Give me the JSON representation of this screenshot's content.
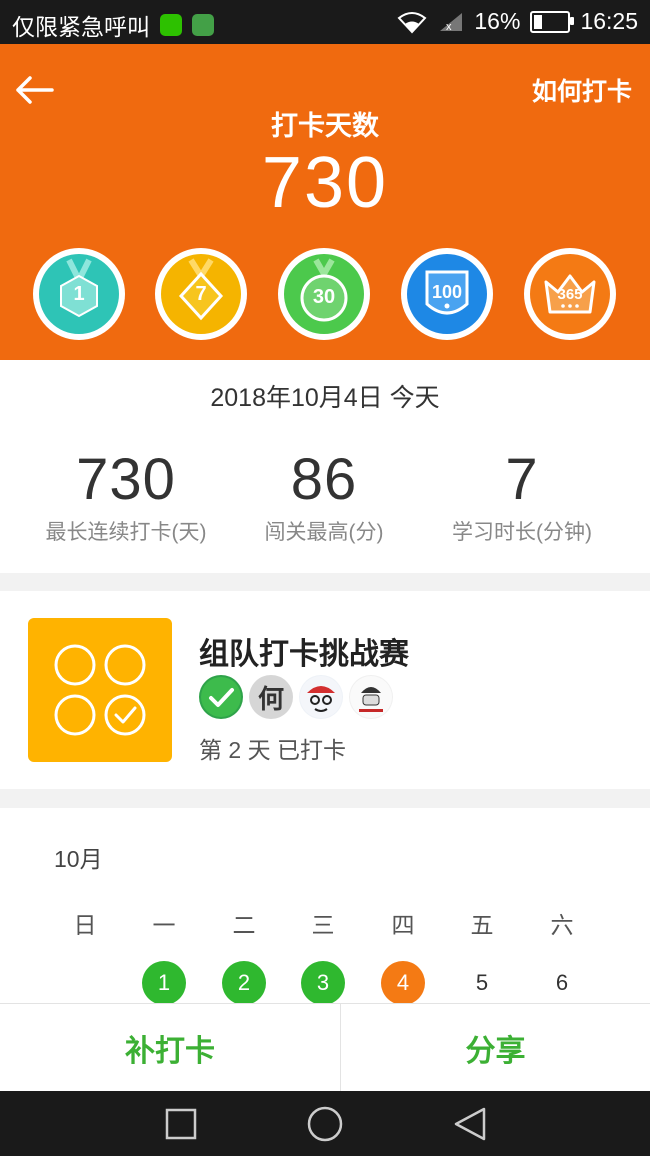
{
  "status_bar": {
    "carrier": "仅限紧急呼叫",
    "battery": "16%",
    "time": "16:25"
  },
  "header": {
    "howto_label": "如何打卡",
    "title": "打卡天数",
    "count": "730",
    "badges": [
      {
        "label": "1",
        "color": "#2ec4b6"
      },
      {
        "label": "7",
        "color": "#f5b400"
      },
      {
        "label": "30",
        "color": "#4cc94c"
      },
      {
        "label": "100",
        "color": "#1e88e5"
      },
      {
        "label": "365",
        "color": "#f47a14"
      }
    ]
  },
  "stats": {
    "date": "2018年10月4日 今天",
    "items": [
      {
        "value": "730",
        "label": "最长连续打卡(天)"
      },
      {
        "value": "86",
        "label": "闯关最高(分)"
      },
      {
        "value": "7",
        "label": "学习时长(分钟)"
      }
    ]
  },
  "team": {
    "title": "组队打卡挑战赛",
    "avatar_text": "何",
    "status": "第 2 天 已打卡"
  },
  "calendar": {
    "month": "10月",
    "weekdays": [
      "日",
      "一",
      "二",
      "三",
      "四",
      "五",
      "六"
    ],
    "days": [
      {
        "n": "1",
        "state": "done"
      },
      {
        "n": "2",
        "state": "done"
      },
      {
        "n": "3",
        "state": "done"
      },
      {
        "n": "4",
        "state": "today"
      },
      {
        "n": "5",
        "state": "normal"
      },
      {
        "n": "6",
        "state": "normal"
      }
    ]
  },
  "actions": {
    "makeup_label": "补打卡",
    "share_label": "分享"
  },
  "colors": {
    "header_bg": "#f06a0f",
    "action_green": "#3cb034",
    "done_green": "#2fb82f",
    "today_orange": "#f47a14",
    "team_yellow": "#ffb300"
  }
}
